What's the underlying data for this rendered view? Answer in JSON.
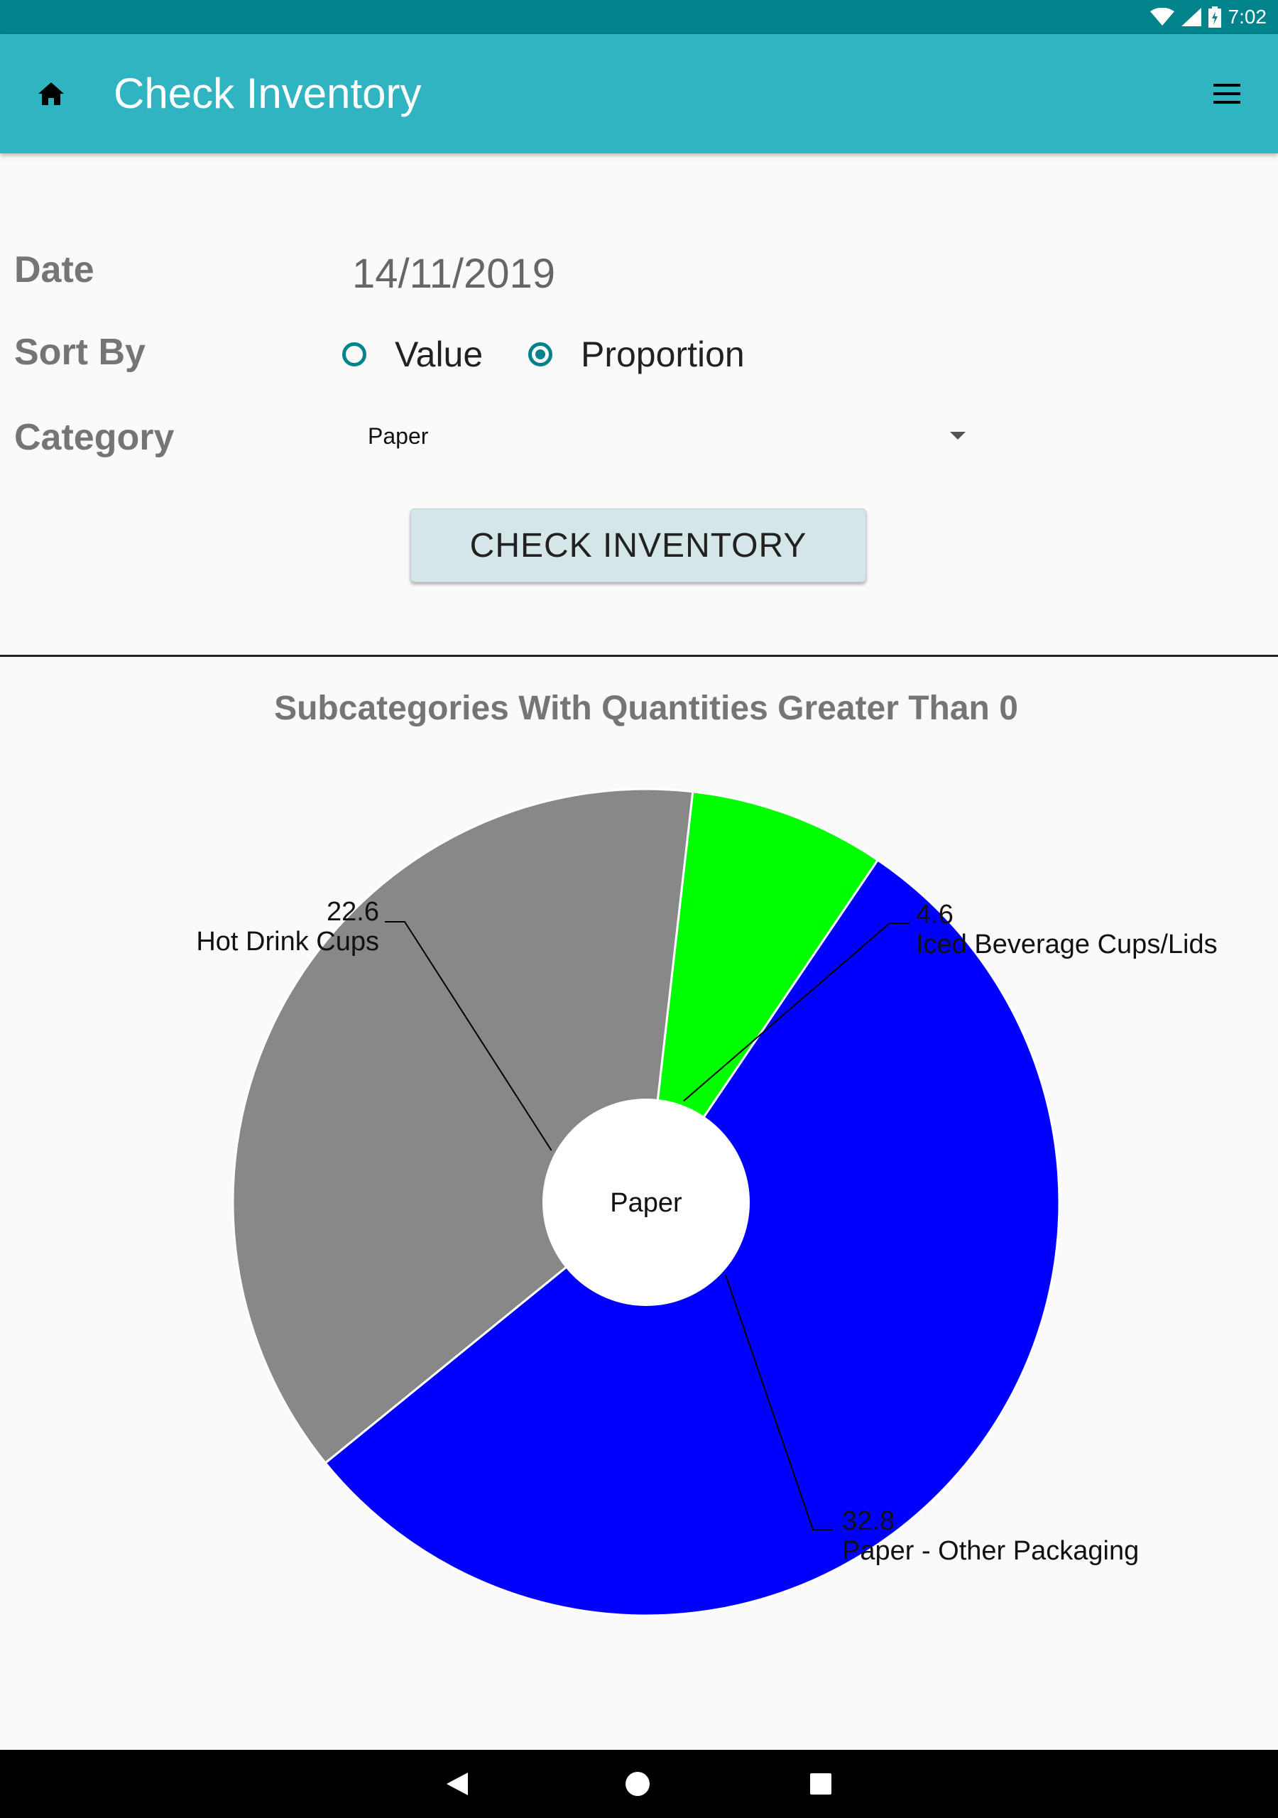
{
  "status_bar": {
    "time": "7:02",
    "icons": [
      "wifi-icon",
      "cell-signal-icon",
      "battery-icon"
    ]
  },
  "app_bar": {
    "title": "Check Inventory",
    "home_icon": "home-icon",
    "menu_icon": "hamburger-menu-icon",
    "background": "#31b4c1"
  },
  "form": {
    "date_label": "Date",
    "date_value": "14/11/2019",
    "sort_label": "Sort By",
    "sort_options": [
      {
        "label": "Value",
        "selected": false
      },
      {
        "label": "Proportion",
        "selected": true
      }
    ],
    "category_label": "Category",
    "category_value": "Paper",
    "button_label": "CHECK INVENTORY"
  },
  "chart_data": {
    "type": "pie",
    "title": "Subcategories With Quantities Greater Than 0",
    "center_label": "Paper",
    "slices": [
      {
        "label": "Hot Drink Cups",
        "value": 22.6,
        "color": "#888888"
      },
      {
        "label": "Iced Beverage Cups/Lids",
        "value": 4.6,
        "color": "#00ff00"
      },
      {
        "label": "Paper - Other Packaging",
        "value": 32.8,
        "color": "#0000ff"
      }
    ]
  },
  "nav_bar": {
    "icons": [
      "back-icon",
      "home-circle-icon",
      "recents-icon"
    ]
  }
}
